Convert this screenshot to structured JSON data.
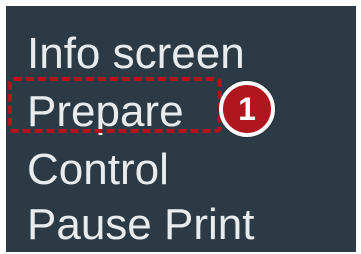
{
  "menu": {
    "items": [
      {
        "label": "Info screen"
      },
      {
        "label": "Prepare"
      },
      {
        "label": "Control"
      },
      {
        "label": "Pause Print"
      }
    ],
    "highlighted_index": 1
  },
  "annotation": {
    "step_number": "1",
    "highlight_color": "#b3121b",
    "badge_color": "#b0161d"
  },
  "colors": {
    "screen_background": "#2b3a44",
    "menu_text": "#e8ecee"
  }
}
